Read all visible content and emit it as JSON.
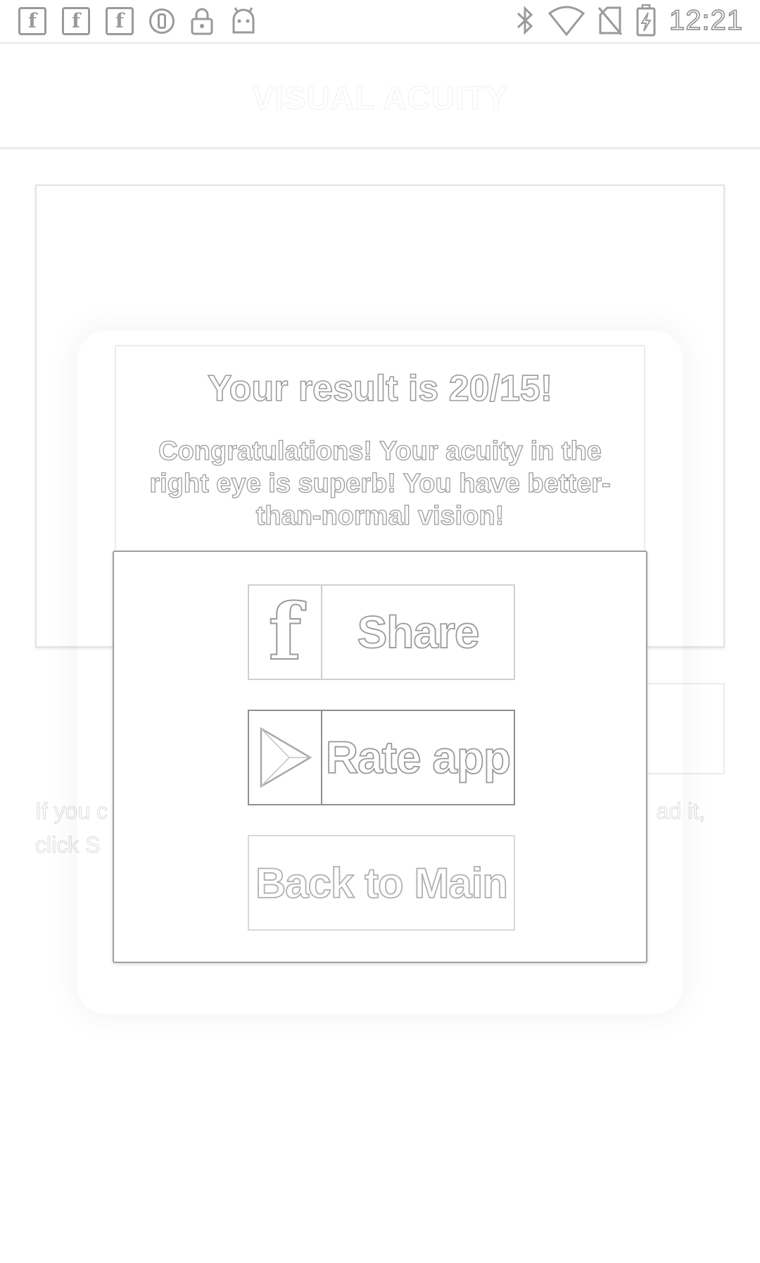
{
  "status_bar": {
    "time": "12:21",
    "notification_icons": [
      "facebook-icon",
      "facebook-icon",
      "facebook-icon",
      "opera-icon",
      "lock-icon",
      "android-icon"
    ],
    "system_icons": [
      "bluetooth-icon",
      "wifi-icon",
      "no-sim-icon",
      "battery-charging-icon"
    ]
  },
  "app_bar": {
    "title": "VISUAL ACUITY"
  },
  "background": {
    "instruction_line1_left": "If you c",
    "instruction_line1_right": "ad it,",
    "instruction_line2_left": "click S"
  },
  "dialog": {
    "result_title": "Your result is 20/15!",
    "result_message": "Congratulations! Your acuity in the right eye is superb! You have better-than-normal vision!",
    "buttons": {
      "share_label": "Share",
      "share_icon": "facebook-icon",
      "rate_label": "Rate app",
      "rate_icon": "play-store-icon",
      "back_label": "Back to Main"
    }
  },
  "colors": {
    "outline_gray": "#9a9a9a",
    "background": "#ffffff"
  }
}
